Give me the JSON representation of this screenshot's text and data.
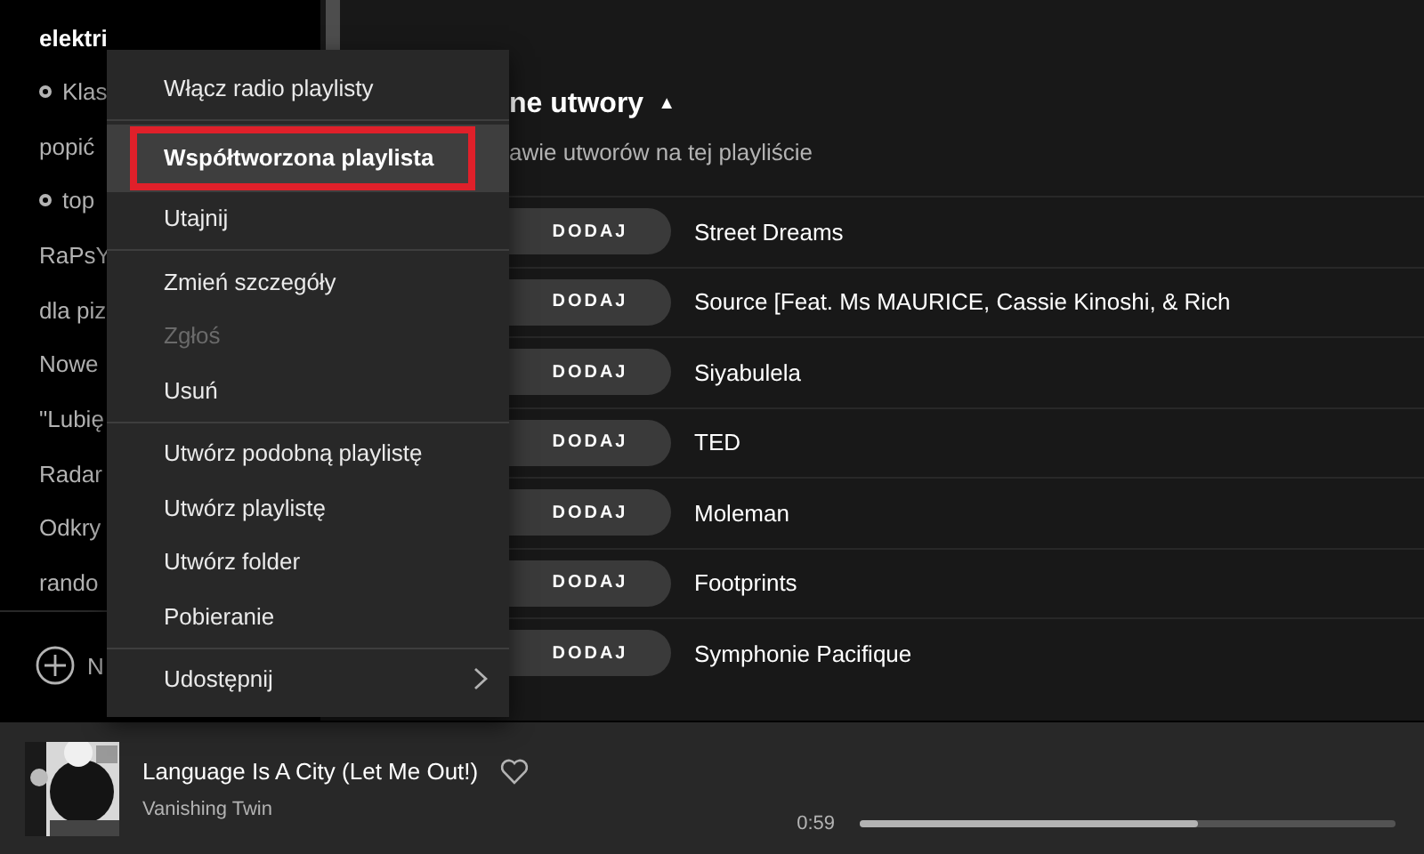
{
  "sidebar": {
    "items": [
      {
        "label": "elektri",
        "downloaded": false
      },
      {
        "label": "Klas",
        "downloaded": true
      },
      {
        "label": "popić",
        "downloaded": false
      },
      {
        "label": "top",
        "downloaded": true
      },
      {
        "label": "RaPsY",
        "downloaded": false
      },
      {
        "label": "dla piz",
        "downloaded": false
      },
      {
        "label": "Nowe",
        "downloaded": false
      },
      {
        "label": "\"Lubię",
        "downloaded": false
      },
      {
        "label": "Radar",
        "downloaded": false
      },
      {
        "label": "Odkry",
        "downloaded": false
      },
      {
        "label": "rando",
        "downloaded": false
      }
    ],
    "new_playlist": "N"
  },
  "section": {
    "title": "ne utwory",
    "sort_icon": "▲",
    "subtitle": "awie utworów na tej playliście"
  },
  "tracks": [
    {
      "button": "DODAJ",
      "title": "Street Dreams"
    },
    {
      "button": "DODAJ",
      "title": "Source [Feat. Ms MAURICE, Cassie Kinoshi, & Rich"
    },
    {
      "button": "DODAJ",
      "title": "Siyabulela"
    },
    {
      "button": "DODAJ",
      "title": "TED"
    },
    {
      "button": "DODAJ",
      "title": "Moleman"
    },
    {
      "button": "DODAJ",
      "title": "Footprints"
    },
    {
      "button": "DODAJ",
      "title": "Symphonie Pacifique"
    }
  ],
  "context_menu": {
    "groups": [
      [
        {
          "label": "Włącz radio playlisty",
          "kind": "item",
          "disabled": false,
          "highlighted": false,
          "annotated": false
        }
      ],
      [
        {
          "label": "Współtworzona playlista",
          "kind": "item",
          "disabled": false,
          "highlighted": true,
          "annotated": true
        },
        {
          "label": "Utajnij",
          "kind": "item",
          "disabled": false,
          "highlighted": false,
          "annotated": false
        }
      ],
      [
        {
          "label": "Zmień szczegóły",
          "kind": "item",
          "disabled": false,
          "highlighted": false,
          "annotated": false
        },
        {
          "label": "Zgłoś",
          "kind": "item",
          "disabled": true,
          "highlighted": false,
          "annotated": false
        },
        {
          "label": "Usuń",
          "kind": "item",
          "disabled": false,
          "highlighted": false,
          "annotated": false
        }
      ],
      [
        {
          "label": "Utwórz podobną playlistę",
          "kind": "item",
          "disabled": false,
          "highlighted": false,
          "annotated": false
        },
        {
          "label": "Utwórz playlistę",
          "kind": "item",
          "disabled": false,
          "highlighted": false,
          "annotated": false
        },
        {
          "label": "Utwórz folder",
          "kind": "item",
          "disabled": false,
          "highlighted": false,
          "annotated": false
        },
        {
          "label": "Pobieranie",
          "kind": "item",
          "disabled": false,
          "highlighted": false,
          "annotated": false
        }
      ],
      [
        {
          "label": "Udostępnij",
          "kind": "submenu",
          "disabled": false,
          "highlighted": false,
          "annotated": false
        }
      ]
    ]
  },
  "player": {
    "title": "Language Is A City (Let Me Out!)",
    "artist": "Vanishing Twin",
    "liked": false,
    "elapsed": "0:59",
    "level": 0.63
  }
}
